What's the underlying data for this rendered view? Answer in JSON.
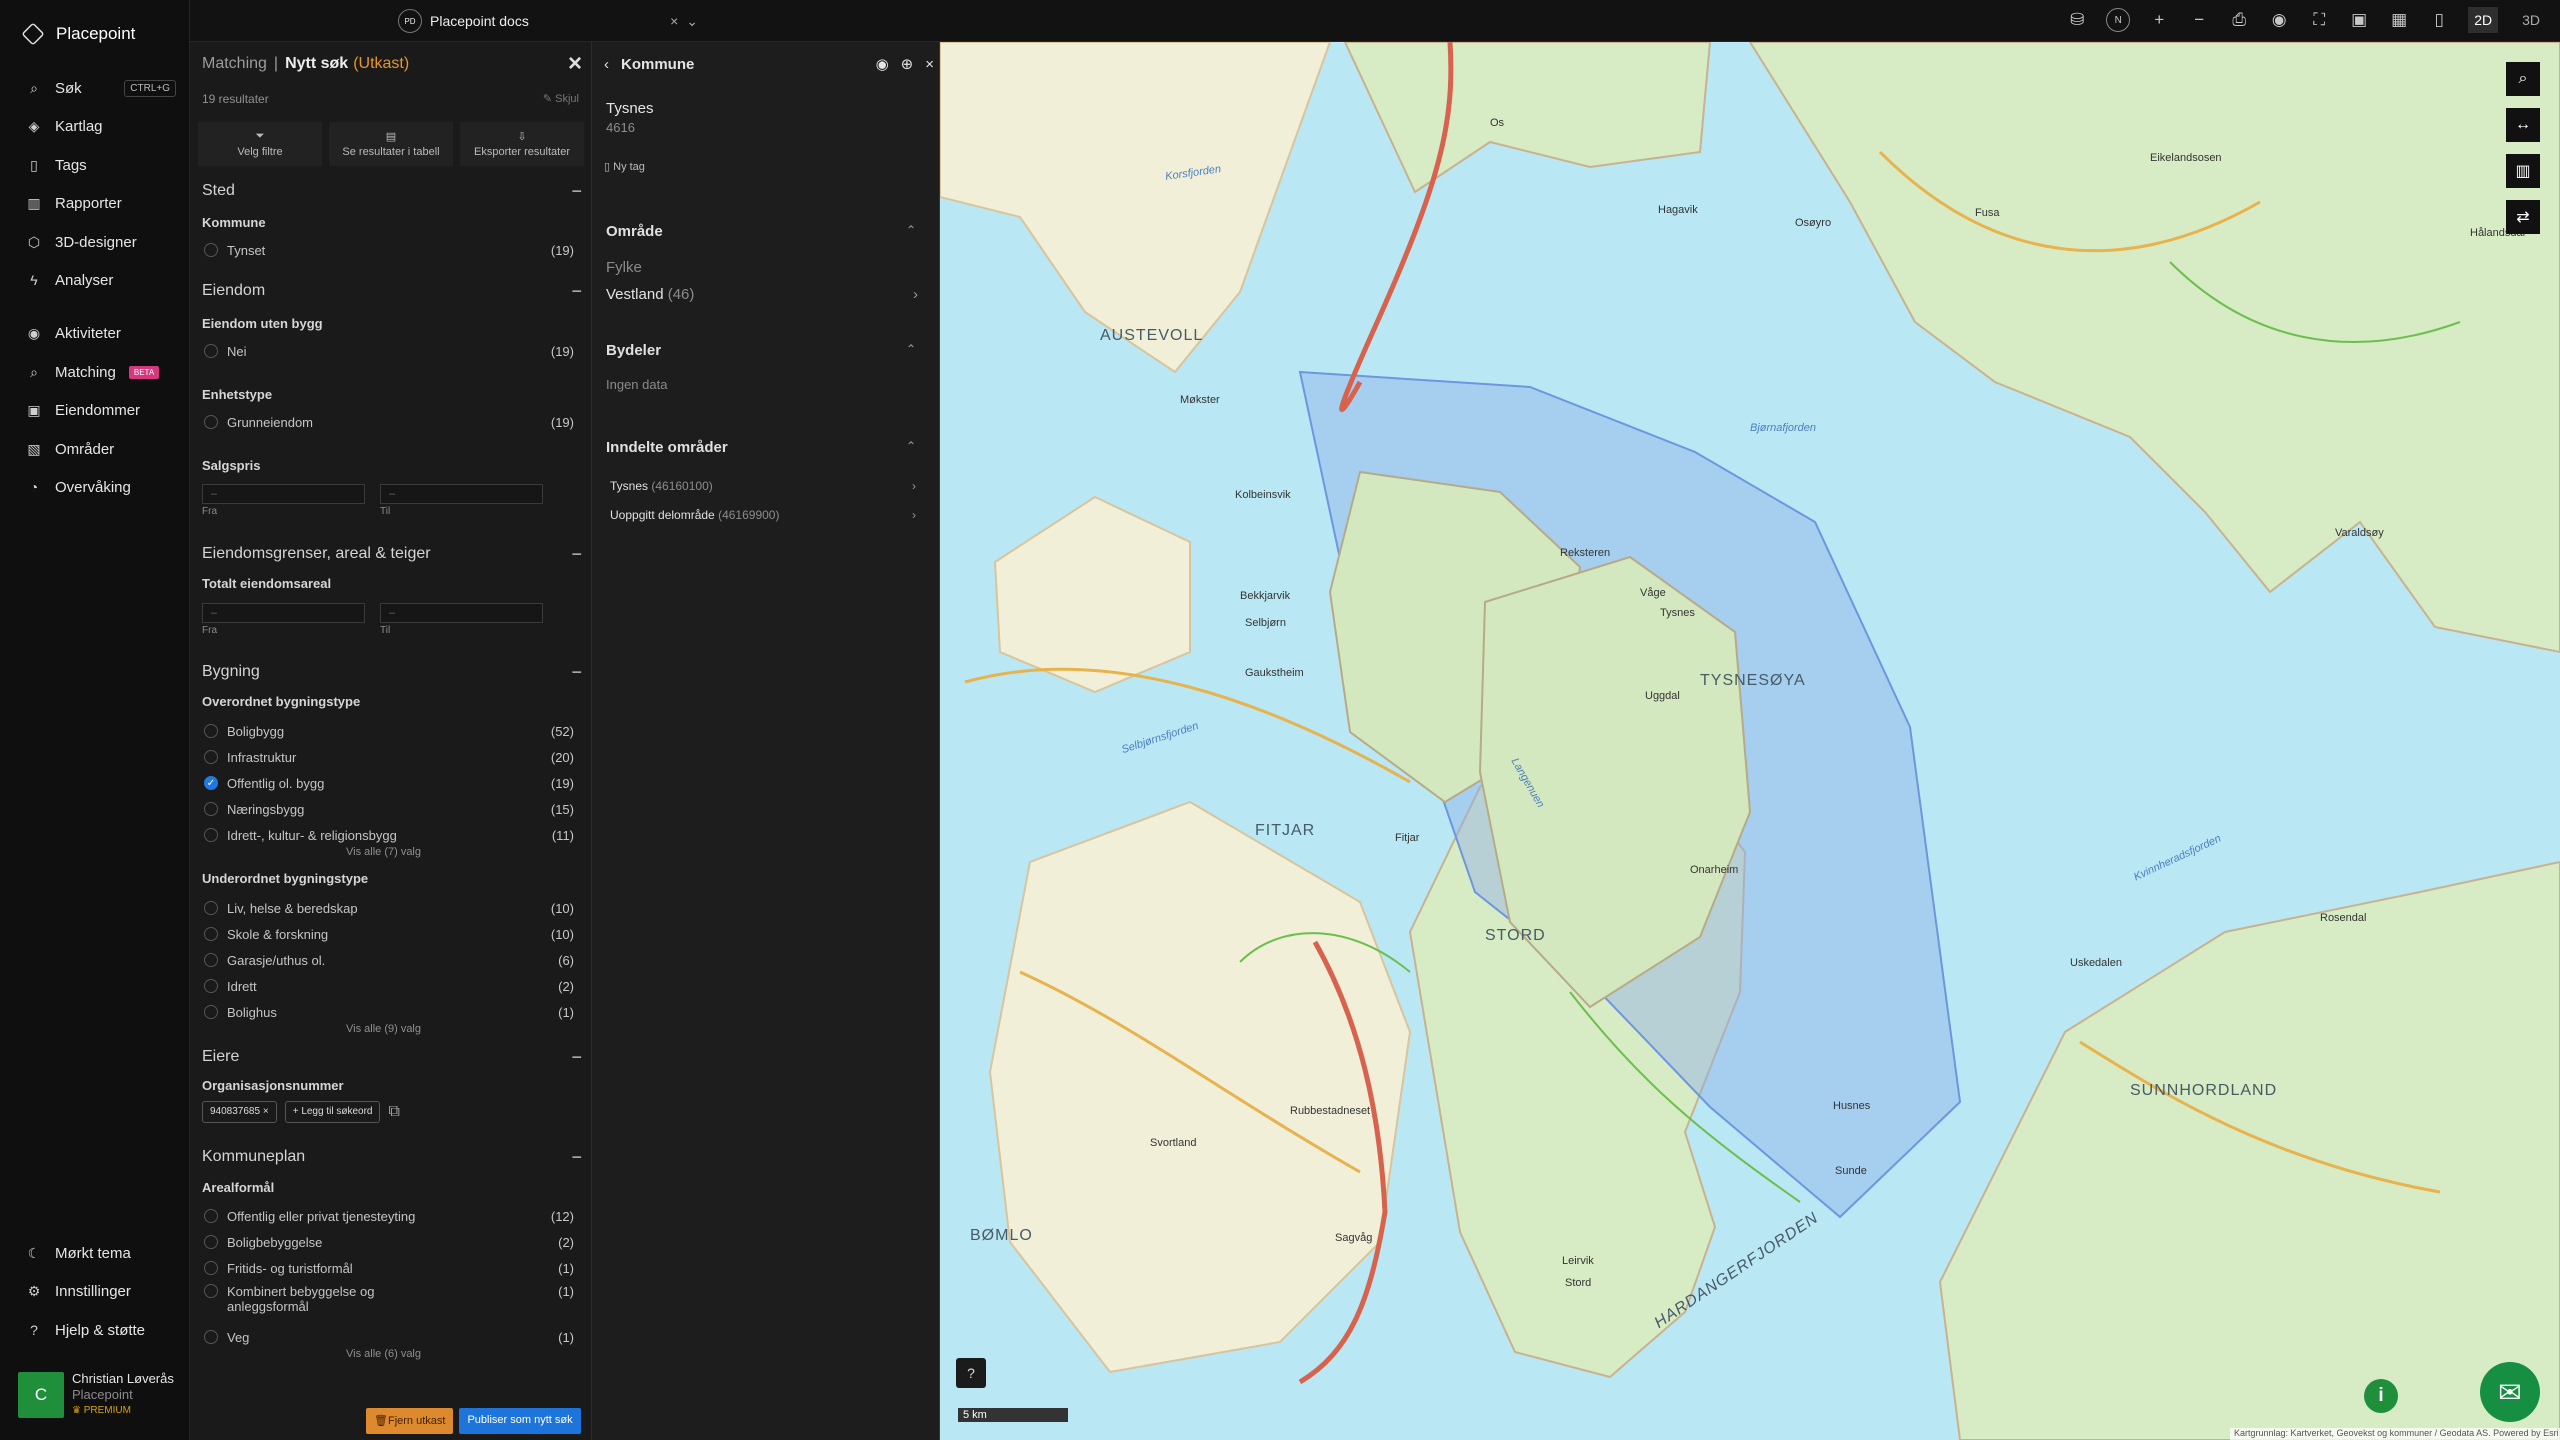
{
  "app": {
    "name": "Placepoint",
    "workspace": "Placepoint docs",
    "workspace_badge": "PD"
  },
  "nav": {
    "items": [
      {
        "label": "Søk",
        "icon": "search-icon",
        "shortcut": "CTRL+G"
      },
      {
        "label": "Kartlag",
        "icon": "layers-icon"
      },
      {
        "label": "Tags",
        "icon": "bookmark-icon"
      },
      {
        "label": "Rapporter",
        "icon": "report-icon"
      },
      {
        "label": "3D-designer",
        "icon": "cube-icon"
      },
      {
        "label": "Analyser",
        "icon": "analyze-icon"
      },
      {
        "label": "Aktiviteter",
        "icon": "activity-icon"
      },
      {
        "label": "Matching",
        "icon": "matching-icon",
        "badge": "BETA"
      },
      {
        "label": "Eiendommer",
        "icon": "buildings-icon"
      },
      {
        "label": "Områder",
        "icon": "area-icon"
      },
      {
        "label": "Overvåking",
        "icon": "monitor-icon"
      }
    ],
    "bottom": [
      {
        "label": "Mørkt tema",
        "icon": "moon-icon"
      },
      {
        "label": "Innstillinger",
        "icon": "gear-icon"
      },
      {
        "label": "Hjelp & støtte",
        "icon": "help-icon"
      }
    ],
    "user": {
      "initial": "C",
      "name": "Christian Løverås",
      "org": "Placepoint",
      "plan": "PREMIUM"
    }
  },
  "matching": {
    "crumb": "Matching",
    "separator": "|",
    "title": "Nytt søk",
    "draft": "(Utkast)",
    "results": "19 resultater",
    "hide": "Skjul",
    "actions": [
      "Velg filtre",
      "Se resultater i tabell",
      "Eksporter resultater"
    ],
    "sections": {
      "sted": "Sted",
      "eiendom": "Eiendom",
      "grenser": "Eiendomsgrenser, areal & teiger",
      "bygning": "Bygning",
      "eiere": "Eiere",
      "kommuneplan": "Kommuneplan"
    },
    "labels": {
      "kommune": "Kommune",
      "uten_bygg": "Eiendom uten bygg",
      "enhetstype": "Enhetstype",
      "salgspris": "Salgspris",
      "totalt_areal": "Totalt eiendomsareal",
      "overordnet": "Overordnet bygningstype",
      "underordnet": "Underordnet bygningstype",
      "orgnr": "Organisasjonsnummer",
      "arealformal": "Arealformål",
      "fra": "Fra",
      "til": "Til",
      "dash": "–"
    },
    "kommune_values": [
      {
        "label": "Tynset",
        "count": "(19)"
      }
    ],
    "uten_bygg_values": [
      {
        "label": "Nei",
        "count": "(19)"
      }
    ],
    "enhetstype_values": [
      {
        "label": "Grunneiendom",
        "count": "(19)"
      }
    ],
    "overordnet_values": [
      {
        "label": "Boligbygg",
        "count": "(52)"
      },
      {
        "label": "Infrastruktur",
        "count": "(20)"
      },
      {
        "label": "Offentlig ol. bygg",
        "count": "(19)",
        "checked": true
      },
      {
        "label": "Næringsbygg",
        "count": "(15)"
      },
      {
        "label": "Idrett-, kultur- & religionsbygg",
        "count": "(11)"
      }
    ],
    "overordnet_more": "Vis alle (7) valg",
    "underordnet_values": [
      {
        "label": "Liv, helse & beredskap",
        "count": "(10)"
      },
      {
        "label": "Skole & forskning",
        "count": "(10)"
      },
      {
        "label": "Garasje/uthus ol.",
        "count": "(6)"
      },
      {
        "label": "Idrett",
        "count": "(2)"
      },
      {
        "label": "Bolighus",
        "count": "(1)"
      }
    ],
    "underordnet_more": "Vis alle (9) valg",
    "org_chip": "940837685",
    "add_search": "Legg til søkeord",
    "arealformal_values": [
      {
        "label": "Offentlig eller privat tjenesteyting",
        "count": "(12)"
      },
      {
        "label": "Boligbebyggelse",
        "count": "(2)"
      },
      {
        "label": "Fritids- og turistformål",
        "count": "(1)"
      },
      {
        "label": "Kombinert bebyggelse og anleggsformål",
        "count": "(1)"
      },
      {
        "label": "Veg",
        "count": "(1)"
      }
    ],
    "arealformal_more": "Vis alle (6) valg",
    "remove_draft": "Fjern utkast",
    "publish": "Publiser som nytt søk"
  },
  "kommune_panel": {
    "title": "Kommune",
    "name": "Tysnes",
    "code": "4616",
    "new_tag": "Ny tag",
    "omrade": "Område",
    "fylke_label": "Fylke",
    "fylke_value": "Vestland",
    "fylke_count": "(46)",
    "bydeler": "Bydeler",
    "no_data": "Ingen data",
    "inndelte": "Inndelte områder",
    "areas": [
      {
        "name": "Tysnes",
        "code": "(46160100)"
      },
      {
        "name": "Uoppgitt delområde",
        "code": "(46169900)"
      }
    ]
  },
  "map": {
    "scale": "5 km",
    "credit": "Kartgrunnlag: Kartverket, Geovekst og kommuner / Geodata AS. Powered by Esri",
    "places": [
      "AUSTEVOLL",
      "Kolbeinsvik",
      "Møkster",
      "Bekkjarvik",
      "Selbjørn",
      "Gaukstheim",
      "FITJAR",
      "Fitjar",
      "STORD",
      "Stord",
      "Leirvik",
      "BØMLO",
      "Svortland",
      "Rubbestadneset",
      "Sagvåg",
      "Tysnes",
      "TYSNESØYA",
      "Uggdal",
      "Onarheim",
      "Våge",
      "Reksteren",
      "Os",
      "Osøyro",
      "Hagavik",
      "Fusa",
      "SUNNHORDLAND",
      "Rosendal",
      "Uskedalen",
      "Husnes",
      "Sunde",
      "HARDANGERFJORDEN",
      "Bjørnafjorden",
      "Selbjørnsfjorden",
      "Langenuen",
      "Korsfjorden",
      "Kvinnheradsfjorden",
      "Eikelandsosen",
      "Hålandsdal",
      "Varaldsøy"
    ],
    "colors": {
      "sea": "#b9e7f3",
      "land": "#f3f0dc",
      "forest": "#cfe8b8",
      "road_main": "#d7634e",
      "road_minor": "#e8b24d",
      "selection": "#7aa6e6"
    }
  }
}
